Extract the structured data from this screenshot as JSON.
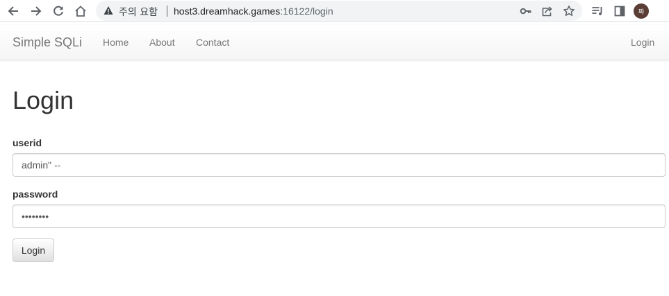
{
  "browser": {
    "security_label": "주의 요함",
    "url_host": "host3.dreamhack.games",
    "url_rest": ":16122/login",
    "avatar_text": "짜",
    "icons": [
      "back-arrow-icon",
      "forward-arrow-icon",
      "reload-icon",
      "home-icon",
      "warning-icon",
      "key-icon",
      "share-icon",
      "star-icon",
      "reading-list-icon",
      "side-panel-icon"
    ]
  },
  "navbar": {
    "brand": "Simple SQLi",
    "links": [
      "Home",
      "About",
      "Contact"
    ],
    "right_link": "Login"
  },
  "main": {
    "title": "Login",
    "userid_label": "userid",
    "userid_value": "admin\" --",
    "password_label": "password",
    "password_value": "password",
    "submit_label": "Login"
  }
}
